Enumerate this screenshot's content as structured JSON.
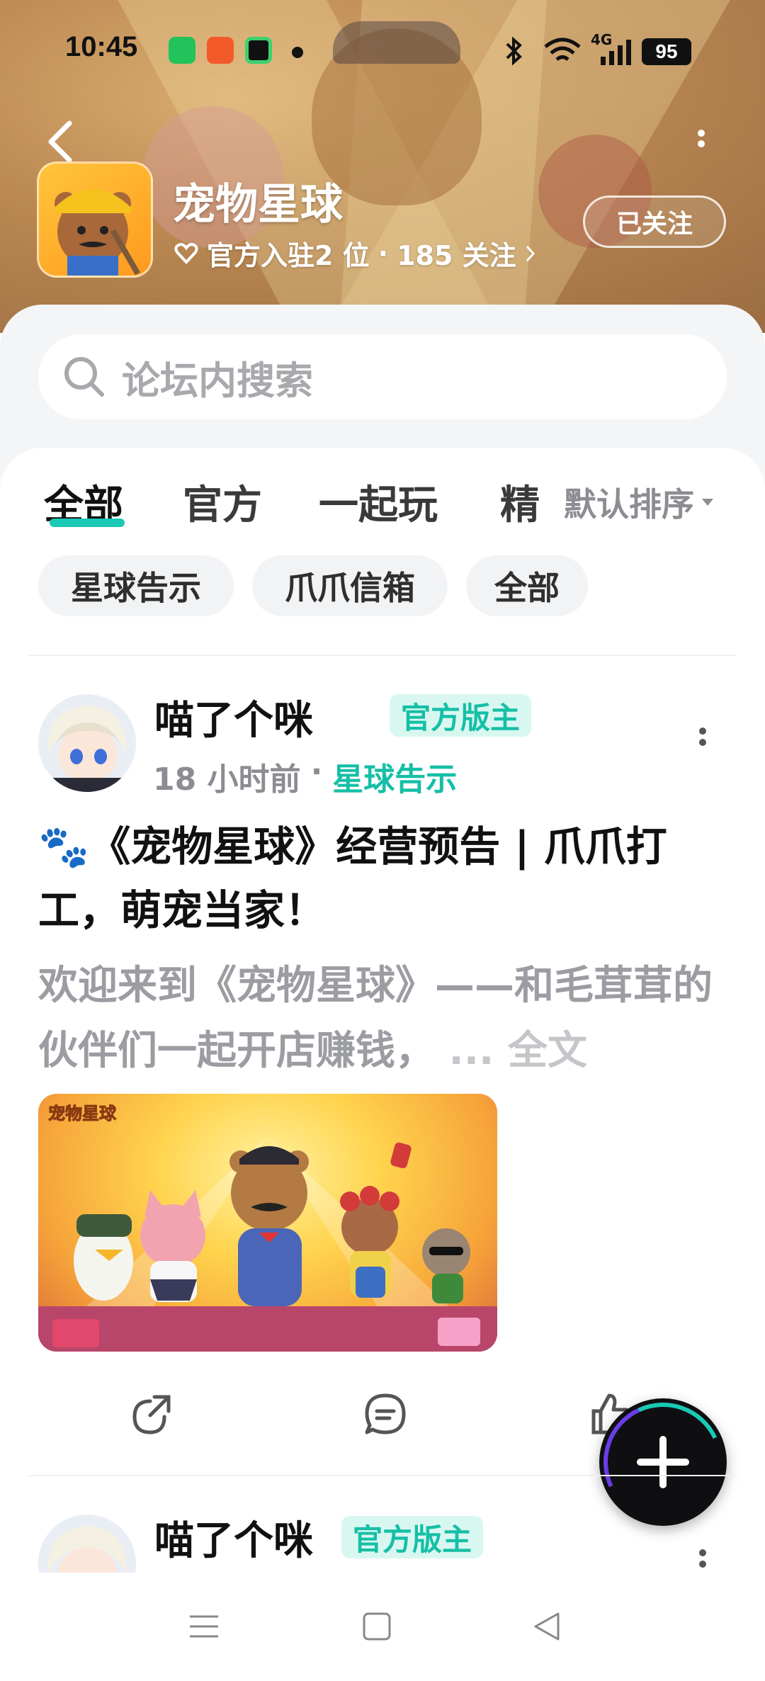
{
  "status_bar": {
    "time": "10:45",
    "network": "4G",
    "battery": "95",
    "icons": [
      "wechat-icon",
      "app-icon",
      "video-app-icon",
      "bluetooth-icon",
      "wifi-icon",
      "signal-icon"
    ]
  },
  "header": {
    "title": "宠物星球",
    "official_count": "官方入驻2 位",
    "separator": "·",
    "followers": "185 关注",
    "follow_button": "已关注"
  },
  "search": {
    "placeholder": "论坛内搜索"
  },
  "tabs": [
    {
      "label": "全部",
      "active": true
    },
    {
      "label": "官方",
      "active": false
    },
    {
      "label": "一起玩",
      "active": false
    },
    {
      "label": "精",
      "active": false
    }
  ],
  "sort": {
    "label": "默认排序"
  },
  "chips": [
    "星球告示",
    "爪爪信箱",
    "全部"
  ],
  "posts": [
    {
      "author": "喵了个咪",
      "badge": "官方版主",
      "time": "18 小时前",
      "dot": "·",
      "category": "星球告示",
      "title": "🐾《宠物星球》经营预告 | 爪爪打工，萌宠当家！",
      "excerpt": "欢迎来到《宠物星球》——和毛茸茸的伙伴们一起开店赚钱，",
      "more": "... 全文",
      "image_logo_text": "宠物星球"
    },
    {
      "author": "喵了个咪",
      "badge": "官方版主"
    }
  ],
  "colors": {
    "accent": "#19c9b4",
    "badge_bg": "#d9f7f1",
    "fab": "#0f0f12"
  }
}
